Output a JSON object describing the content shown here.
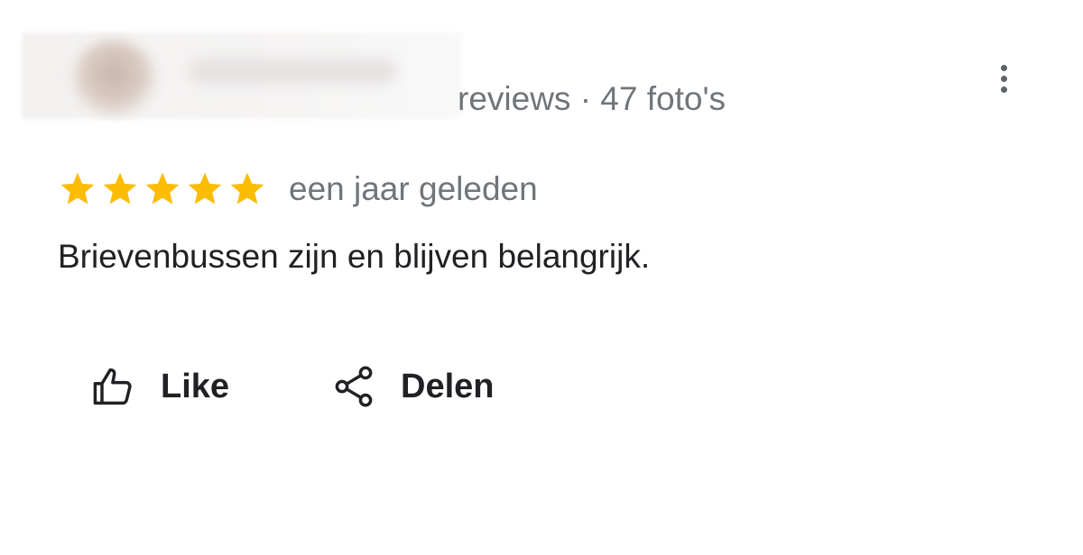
{
  "review": {
    "meta_suffix": "reviews · 47 foto's",
    "rating": 5,
    "max_rating": 5,
    "date": "een jaar geleden",
    "text": "Brievenbussen zijn en blijven belangrijk."
  },
  "actions": {
    "like_label": "Like",
    "share_label": "Delen"
  },
  "icons": {
    "star": "star-icon",
    "more": "more-vert-icon",
    "like": "thumb-up-icon",
    "share": "share-icon"
  },
  "colors": {
    "star": "#fbbc04",
    "secondary_text": "#70757a",
    "primary_text": "#202124"
  }
}
